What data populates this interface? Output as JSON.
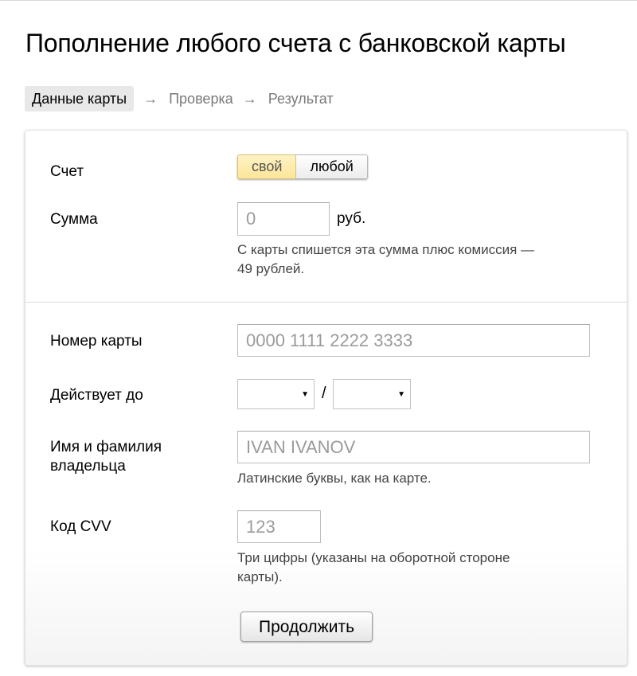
{
  "title": "Пополнение любого счета с банковской карты",
  "steps": {
    "active": "Данные карты",
    "second": "Проверка",
    "third": "Результат",
    "arrow": "→"
  },
  "account": {
    "label": "Счет",
    "own": "свой",
    "any": "любой",
    "selected": "свой"
  },
  "amount": {
    "label": "Сумма",
    "placeholder": "0",
    "unit": "руб.",
    "hint_line1": "С карты спишется эта сумма плюс комиссия —",
    "hint_line2": "49 рублей."
  },
  "card_number": {
    "label": "Номер карты",
    "placeholder": "0000 1111 2222 3333"
  },
  "expiry": {
    "label": "Действует до",
    "separator": "/",
    "month_value": "",
    "year_value": ""
  },
  "holder": {
    "label_line1": "Имя и фамилия",
    "label_line2": "владельца",
    "placeholder": "IVAN IVANOV",
    "hint": "Латинские буквы, как на карте."
  },
  "cvv": {
    "label": "Код CVV",
    "placeholder": "123",
    "hint_line1": "Три цифры (указаны на оборотной стороне",
    "hint_line2": "карты)."
  },
  "submit": {
    "label": "Продолжить"
  }
}
